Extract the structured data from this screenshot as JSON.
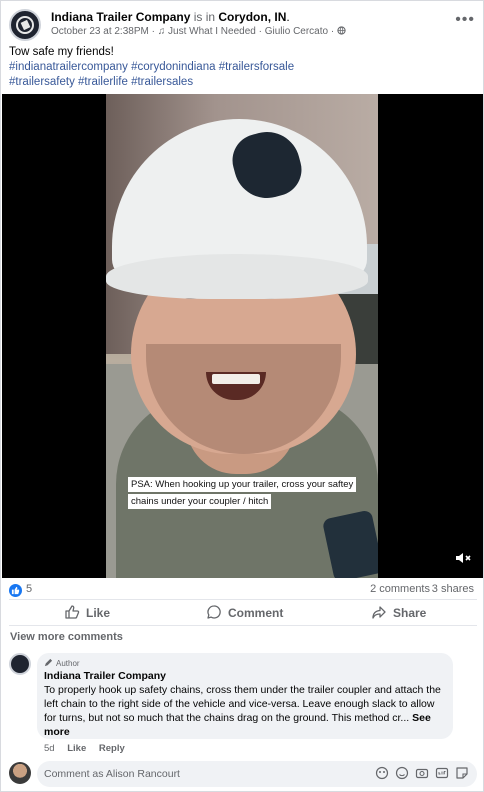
{
  "post": {
    "page_name": "Indiana Trailer Company",
    "is_in": " is in ",
    "location": "Corydon, IN",
    "location_suffix": ".",
    "date": "October 23 at 2:38PM",
    "sep": " · ",
    "music_note": "♫",
    "song": " Just What I Needed · Giulio Cercato · ",
    "more_glyph": "•••",
    "caption_text": "Tow safe my friends!",
    "hashtags_line1": "#indianatrailercompany #corydonindiana #trailersforsale",
    "hashtags_line2": " #trailersafety #trailerlife #trailersales"
  },
  "video": {
    "overlay_text": "PSA: When hooking up your trailer, cross your saftey chains under your coupler / hitch"
  },
  "stats": {
    "reactions": "5",
    "comments": "2 comments",
    "shares": "3 shares"
  },
  "actions": {
    "like": "Like",
    "comment": "Comment",
    "share": "Share"
  },
  "comments": {
    "view_more": "View more comments",
    "items": [
      {
        "badge": "Author",
        "name": "Indiana Trailer Company",
        "text": "To properly hook up safety chains, cross them under the trailer coupler and attach the left chain to the right side of the vehicle and vice-versa. Leave enough slack to allow for turns, but not so much that the chains drag on the ground. This method cr... ",
        "see_more": "See more",
        "age": "5d",
        "like": "Like",
        "reply": "Reply"
      }
    ],
    "compose_placeholder": "Comment as Alison Rancourt"
  },
  "colors": {
    "accent": "#1877f2",
    "hashtag": "#385898",
    "muted": "#65676b",
    "bubble": "#f0f2f5"
  },
  "icons": [
    "page-avatar-icon",
    "music-note-icon",
    "globe-icon",
    "more-icon",
    "mute-icon",
    "like-reaction-icon",
    "thumbs-up-icon",
    "comment-icon",
    "share-icon",
    "pencil-icon",
    "emoji-icon",
    "camera-icon",
    "gif-icon",
    "sticker-icon"
  ]
}
